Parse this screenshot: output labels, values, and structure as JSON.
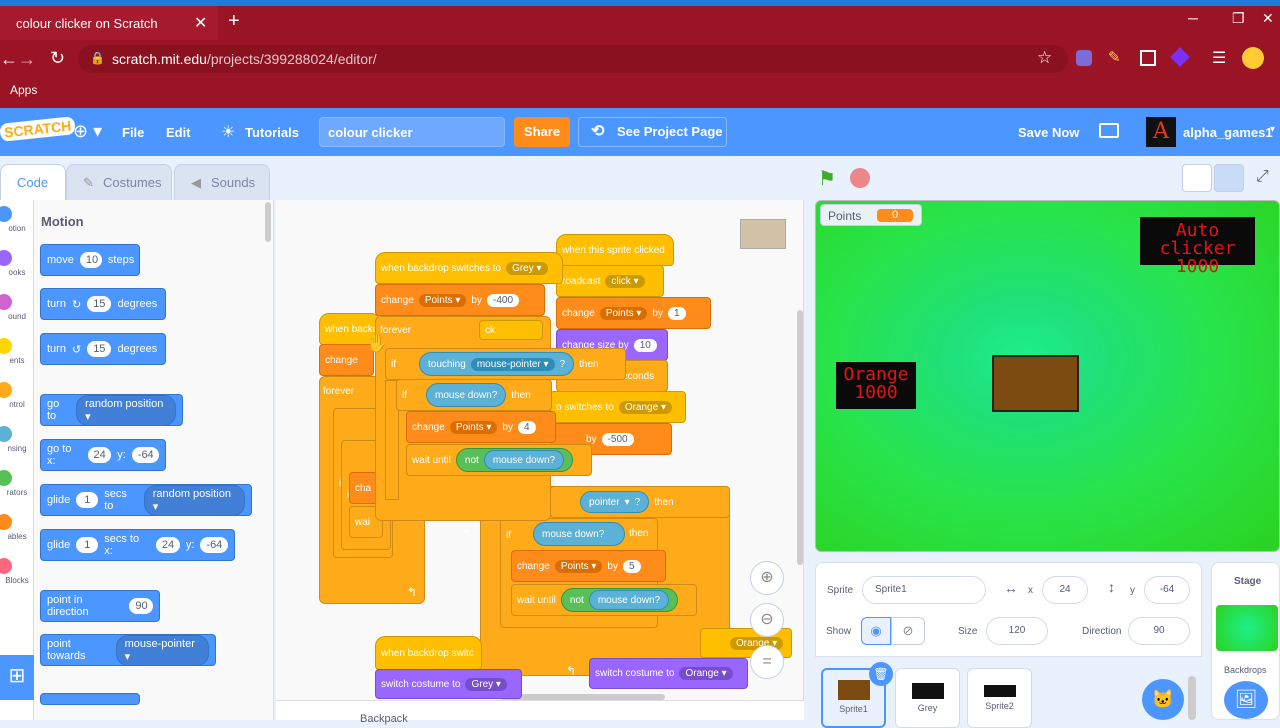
{
  "browser": {
    "tab_title": "colour clicker on Scratch",
    "url_host": "scratch.mit.edu",
    "url_path": "/projects/399288024/editor/",
    "bookmark": "Apps"
  },
  "menubar": {
    "logo": "SCRATCH",
    "file": "File",
    "edit": "Edit",
    "tutorials": "Tutorials",
    "project_title": "colour clicker",
    "share": "Share",
    "see_project": "See Project Page",
    "save_now": "Save Now",
    "username": "alpha_games1",
    "avatar_letter": "A"
  },
  "tabs": {
    "code": "Code",
    "costumes": "Costumes",
    "sounds": "Sounds"
  },
  "categories": [
    "otion",
    "ooks",
    "ound",
    "ents",
    "ntrol",
    "nsing",
    "rators",
    "ables",
    "Blocks"
  ],
  "category_colors": [
    "#4c97ff",
    "#9966ff",
    "#cf63cf",
    "#ffd500",
    "#ffab19",
    "#5cb1d6",
    "#59c059",
    "#ff8c1a",
    "#ff6680"
  ],
  "palette": {
    "heading": "Motion",
    "move": {
      "a": "move",
      "v": "10",
      "b": "steps"
    },
    "turn_right": {
      "a": "turn",
      "v": "15",
      "b": "degrees"
    },
    "turn_left": {
      "a": "turn",
      "v": "15",
      "b": "degrees"
    },
    "goto": {
      "a": "go to",
      "d": "random position"
    },
    "gotoxy": {
      "a": "go to x:",
      "x": "24",
      "b": "y:",
      "y": "-64"
    },
    "glide_random": {
      "a": "glide",
      "v": "1",
      "b": "secs to",
      "d": "random position"
    },
    "glide_xy": {
      "a": "glide",
      "v": "1",
      "b": "secs to x:",
      "x": "24",
      "c": "y:",
      "y": "-64"
    },
    "point_dir": {
      "a": "point in direction",
      "v": "90"
    },
    "point_towards": {
      "a": "point towards",
      "d": "mouse-pointer"
    }
  },
  "scripts": {
    "when_backdrop_grey": "when backdrop switches to",
    "grey": "Grey",
    "change": "change",
    "points": "Points",
    "by": "by",
    "neg400": "-400",
    "forever": "forever",
    "if": "if",
    "touching": "touching",
    "mouse_pointer": "mouse-pointer",
    "q": "?",
    "then": "then",
    "mouse_down": "mouse down?",
    "v4": "4",
    "v5": "5",
    "wait_until": "wait until",
    "not": "not",
    "when_sprite_clicked": "when this sprite clicked",
    "broadcast": "roadcast",
    "click": "click",
    "v1": "1",
    "change_size": "change size by",
    "v10": "10",
    "seconds": "econds",
    "switches_to": "o switches to",
    "orange": "Orange",
    "neg500": "-500",
    "pointer_frag": "pointer",
    "when_backd": "when backd",
    "when_backdrop_switch": "when backdrop switc",
    "switch_costume": "switch costume to",
    "cha": "cha",
    "wai": "wai",
    "ck": "ck",
    "icked": "icked",
    "change_short": "change"
  },
  "stage": {
    "var_name": "Points",
    "var_value": "0",
    "auto_label": "Auto clicker",
    "auto_value": "1000",
    "orange_label": "Orange",
    "orange_value": "1000"
  },
  "sprite_info": {
    "sprite_label": "Sprite",
    "sprite_name": "Sprite1",
    "x_label": "x",
    "x": "24",
    "y_label": "y",
    "y": "-64",
    "show_label": "Show",
    "size_label": "Size",
    "size": "120",
    "direction_label": "Direction",
    "direction": "90"
  },
  "sprites": [
    "Sprite1",
    "Grey",
    "Sprite2"
  ],
  "stage_panel": {
    "title": "Stage",
    "backdrops": "Backdrops"
  },
  "backpack": "Backpack"
}
